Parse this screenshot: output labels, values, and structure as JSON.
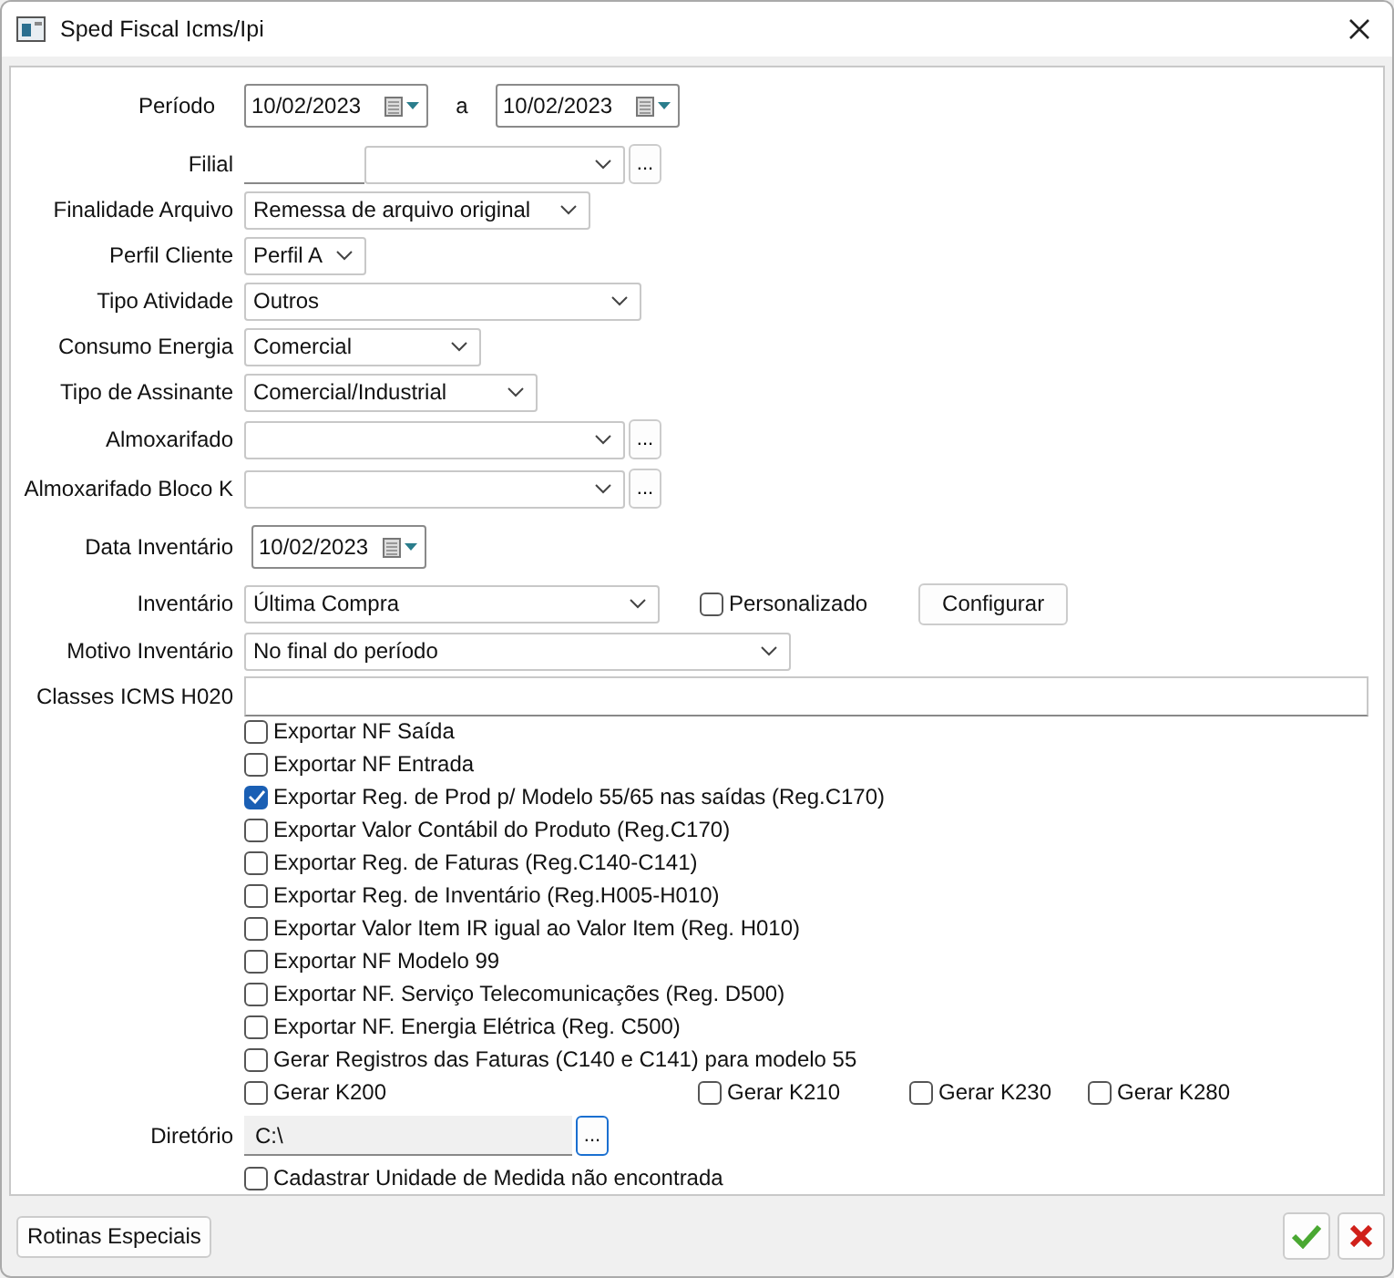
{
  "window": {
    "title": "Sped Fiscal Icms/Ipi"
  },
  "form": {
    "fields": [
      {
        "kind": "date_range",
        "label": "Período",
        "from": "10/02/2023",
        "separator": "a",
        "to": "10/02/2023"
      },
      {
        "kind": "lookup",
        "label": "Filial",
        "button": "..."
      },
      {
        "kind": "combo",
        "label": "Finalidade Arquivo",
        "value": "Remessa de arquivo original"
      },
      {
        "kind": "combo",
        "label": "Perfil Cliente",
        "value": "Perfil A"
      },
      {
        "kind": "combo",
        "label": "Tipo Atividade",
        "value": "Outros"
      },
      {
        "kind": "combo",
        "label": "Consumo Energia",
        "value": "Comercial"
      },
      {
        "kind": "combo",
        "label": "Tipo de Assinante",
        "value": "Comercial/Industrial"
      },
      {
        "kind": "combo_button",
        "label": "Almoxarifado",
        "button": "..."
      },
      {
        "kind": "combo_button",
        "label": "Almoxarifado Bloco K",
        "button": "..."
      },
      {
        "kind": "date",
        "label": "Data Inventário",
        "value": "10/02/2023"
      },
      {
        "kind": "combo_extra",
        "label": "Inventário",
        "value": "Última Compra",
        "checkbox": {
          "label": "Personalizado",
          "checked": false
        },
        "button": "Configurar"
      },
      {
        "kind": "combo",
        "label": "Motivo Inventário",
        "value": "No final do período"
      },
      {
        "kind": "text",
        "label": "Classes ICMS H020"
      }
    ],
    "options": [
      {
        "label": "Exportar NF Saída",
        "checked": false
      },
      {
        "label": "Exportar NF Entrada",
        "checked": false
      },
      {
        "label": "Exportar Reg. de Prod p/ Modelo 55/65 nas saídas (Reg.C170)",
        "checked": true
      },
      {
        "label": "Exportar Valor Contábil do Produto (Reg.C170)",
        "checked": false
      },
      {
        "label": "Exportar Reg. de Faturas (Reg.C140-C141)",
        "checked": false
      },
      {
        "label": "Exportar Reg. de Inventário (Reg.H005-H010)",
        "checked": false
      },
      {
        "label": "Exportar Valor Item IR igual ao Valor Item (Reg. H010)",
        "checked": false
      },
      {
        "label": "Exportar NF Modelo 99",
        "checked": false
      },
      {
        "label": "Exportar NF. Serviço Telecomunicações (Reg. D500)",
        "checked": false
      },
      {
        "label": "Exportar NF. Energia Elétrica (Reg. C500)",
        "checked": false
      },
      {
        "label": "Gerar Registros das Faturas (C140 e C141) para modelo 55",
        "checked": false
      }
    ],
    "k_options": [
      {
        "label": "Gerar K200",
        "checked": false
      },
      {
        "label": "Gerar K210",
        "checked": false
      },
      {
        "label": "Gerar K230",
        "checked": false
      },
      {
        "label": "Gerar K280",
        "checked": false
      }
    ],
    "directory": {
      "label": "Diretório",
      "value": "C:\\",
      "button": "..."
    },
    "final_option": {
      "label": "Cadastrar Unidade de Medida não encontrada",
      "checked": false
    }
  },
  "footer": {
    "button": "Rotinas Especiais"
  }
}
